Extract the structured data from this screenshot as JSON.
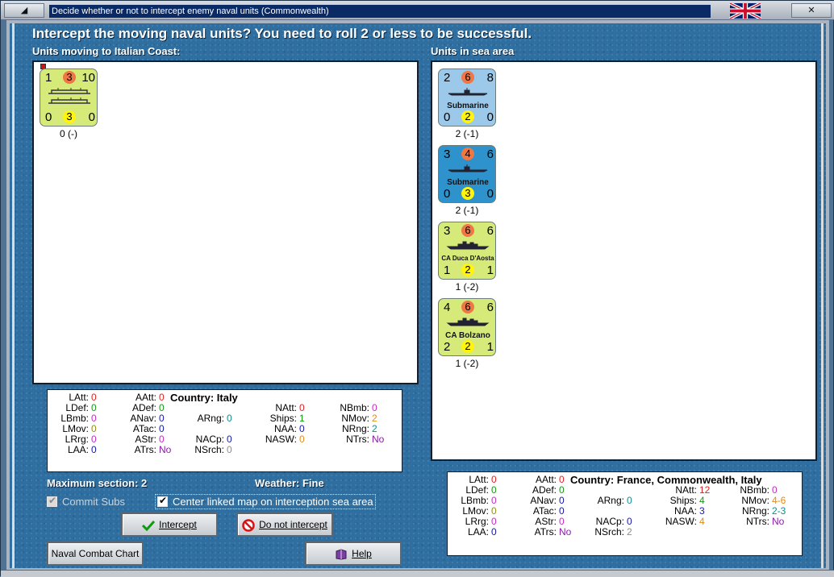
{
  "window": {
    "title": "Decide whether or not to intercept enemy naval units (Commonwealth)",
    "flag": "united-kingdom-flag"
  },
  "prompt": "Intercept the moving naval units?  You need to roll 2 or less to be successful.",
  "left_panel": {
    "label": "Units moving to Italian Coast:",
    "units": [
      {
        "top": [
          "1",
          "3",
          "10"
        ],
        "bottom": [
          "0",
          "3",
          "0"
        ],
        "name": "",
        "caption": "0 (-)",
        "color": "#d6ea7a",
        "icon": "convoy-ships-icon"
      }
    ]
  },
  "right_panel": {
    "label": "Units in sea area",
    "units": [
      {
        "top": [
          "2",
          "6",
          "8"
        ],
        "bottom": [
          "0",
          "2",
          "0"
        ],
        "name": "Submarine",
        "caption": "2 (-1)",
        "color": "#9cc9ea",
        "icon": "submarine-icon"
      },
      {
        "top": [
          "3",
          "4",
          "6"
        ],
        "bottom": [
          "0",
          "3",
          "0"
        ],
        "name": "Submarine",
        "caption": "2 (-1)",
        "color": "#2e93cc",
        "icon": "submarine-icon"
      },
      {
        "top": [
          "3",
          "6",
          "6"
        ],
        "bottom": [
          "1",
          "2",
          "1"
        ],
        "name": "CA Duca D'Aosta",
        "caption": "1 (-2)",
        "color": "#d6ea7a",
        "icon": "cruiser-icon"
      },
      {
        "top": [
          "4",
          "6",
          "6"
        ],
        "bottom": [
          "2",
          "2",
          "1"
        ],
        "name": "CA Bolzano",
        "caption": "1 (-2)",
        "color": "#d6ea7a",
        "icon": "cruiser-icon"
      }
    ]
  },
  "info_left": {
    "country": "Country: Italy",
    "stats": {
      "LAtt": "0",
      "LDef": "0",
      "LBmb": "0",
      "LMov": "0",
      "LRrg": "0",
      "LAA": "0",
      "AAtt": "0",
      "ADef": "0",
      "ANav": "0",
      "ATac": "0",
      "AStr": "0",
      "ATrs": "No",
      "ARng": "0",
      "NACp": "0",
      "NSrch": "0",
      "NAtt": "0",
      "Ships": "1",
      "NAA": "0",
      "NASW": "0",
      "NBmb": "0",
      "NMov": "2",
      "NRng": "2",
      "NTrs": "No"
    }
  },
  "info_right": {
    "country": "Country: France, Commonwealth, Italy",
    "stats": {
      "LAtt": "0",
      "LDef": "0",
      "LBmb": "0",
      "LMov": "0",
      "LRrg": "0",
      "LAA": "0",
      "AAtt": "0",
      "ADef": "0",
      "ANav": "0",
      "ATac": "0",
      "AStr": "0",
      "ATrs": "No",
      "ARng": "0",
      "NACp": "0",
      "NSrch": "2",
      "NAtt": "12",
      "Ships": "4",
      "NAA": "3",
      "NASW": "4",
      "NBmb": "0",
      "NMov": "4-6",
      "NRng": "2-3",
      "NTrs": "No"
    }
  },
  "status": {
    "max_section": "Maximum section: 2",
    "weather": "Weather:  Fine"
  },
  "options": {
    "commit_subs": "Commit Subs",
    "center_map": "Center linked map on interception sea area"
  },
  "buttons": {
    "intercept": "Intercept",
    "do_not_intercept": "Do not intercept",
    "naval_combat_chart": "Naval Combat Chart",
    "help": "Help"
  }
}
